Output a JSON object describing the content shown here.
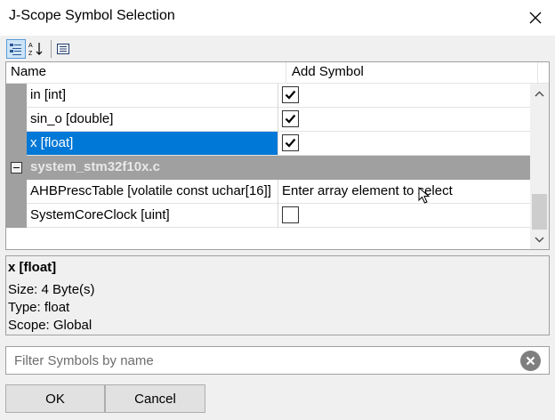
{
  "window": {
    "title": "J-Scope Symbol Selection"
  },
  "toolbar": {
    "buttons": [
      {
        "icon": "categorized-view-icon",
        "active": true
      },
      {
        "icon": "alphabetical-sort-icon",
        "active": false
      },
      {
        "icon": "property-pages-icon",
        "active": false
      }
    ]
  },
  "grid": {
    "columns": {
      "name": "Name",
      "add": "Add Symbol"
    },
    "rows": [
      {
        "name": "in [int]",
        "checked": true
      },
      {
        "name": "sin_o [double]",
        "checked": true
      },
      {
        "name": "x [float]",
        "checked": true,
        "selected": true
      }
    ],
    "category": {
      "label": "system_stm32f10x.c",
      "expanded": true
    },
    "category_rows": [
      {
        "name": "AHBPrescTable [volatile const uchar[16]]",
        "value": "Enter array element to select"
      },
      {
        "name": "SystemCoreClock [uint]",
        "checked": false
      }
    ]
  },
  "info": {
    "title": "x [float]",
    "size": "Size:  4 Byte(s)",
    "type": "Type:  float",
    "scope": "Scope:  Global"
  },
  "filter": {
    "placeholder": "Filter Symbols by name",
    "value": ""
  },
  "buttons": {
    "ok": "OK",
    "cancel": "Cancel"
  },
  "colors": {
    "selection": "#0078d7",
    "category_bg": "#a0a0a0",
    "window_bg": "#f0f0f0"
  }
}
